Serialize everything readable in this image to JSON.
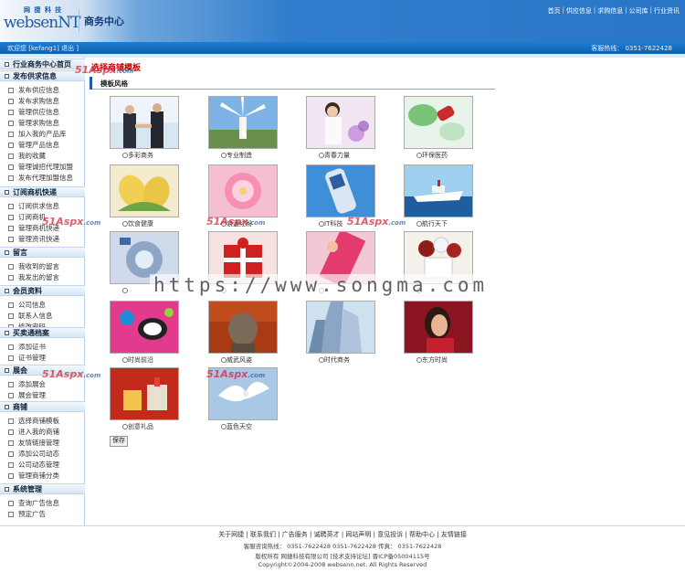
{
  "header": {
    "logo_small": "网 捷 科 技",
    "logo_main": "websenNT",
    "site_title": "商务中心",
    "nav": [
      "首页",
      "供应信息",
      "求购信息",
      "公司库",
      "行业资讯"
    ]
  },
  "info_bar": {
    "welcome": "欢迎您 [kefang1] 退出 ]",
    "hotline": "客服热线： 0351-7622428"
  },
  "sidebar": {
    "sections": [
      {
        "title": "行业商务中心首页",
        "items": []
      },
      {
        "title": "发布供求信息",
        "items": [
          "发布供应信息",
          "发布求购信息",
          "管理供应信息",
          "管理求购信息",
          "加入我的产品库",
          "管理产品信息",
          "我的收藏",
          "管理诚招代理加盟",
          "发布代理加盟信息"
        ]
      },
      {
        "title": "订阅商机快递",
        "items": [
          "订阅供求信息",
          "订阅商机",
          "管理商机快递",
          "管理资讯快递"
        ]
      },
      {
        "title": "留言",
        "items": [
          "我收到的留言",
          "我发出的留言"
        ]
      },
      {
        "title": "会员资料",
        "items": [
          "公司信息",
          "联系人信息",
          "修改密码"
        ]
      },
      {
        "title": "买卖通档案",
        "items": [
          "添加证书",
          "证书管理"
        ]
      },
      {
        "title": "展会",
        "items": [
          "添加展会",
          "展会管理"
        ]
      },
      {
        "title": "商铺",
        "items": [
          "选择商铺模板",
          "进入我的商铺",
          "友情链接管理",
          "添加公司动态",
          "公司动态管理",
          "管理商铺分类"
        ]
      },
      {
        "title": "系统管理",
        "items": [
          "查询广告信息",
          "预定广告"
        ]
      }
    ]
  },
  "main": {
    "title": "选择商铺模板",
    "section_label": "模板风格",
    "templates": [
      {
        "label": "多彩商务"
      },
      {
        "label": "专业制造"
      },
      {
        "label": "青春力量"
      },
      {
        "label": "环保医药"
      },
      {
        "label": "饮食健康"
      },
      {
        "label": "浪漫红粉"
      },
      {
        "label": "IT科技"
      },
      {
        "label": "航行天下"
      },
      {
        "label": ""
      },
      {
        "label": ""
      },
      {
        "label": ""
      },
      {
        "label": ""
      },
      {
        "label": "时尚前沿"
      },
      {
        "label": "威武风姿"
      },
      {
        "label": "时代商务"
      },
      {
        "label": "东方时尚"
      },
      {
        "label": "创意礼品"
      },
      {
        "label": "蓝色天空"
      }
    ],
    "save_label": "保存"
  },
  "watermarks": {
    "brand": "51Aspx",
    "suffix": ".com",
    "banner": "https://www.songma.com"
  },
  "footer": {
    "links": [
      "关于网捷",
      "联系我们",
      "广告服务",
      "诚聘英才",
      "网站声明",
      "意见投诉",
      "帮助中心",
      "友情链接"
    ],
    "line1": "客服咨询热线： 0351-7622428  0351-7622428  传真： 0351-7622428",
    "line2": "版权所有 网捷科技有限公司 [技术支持论坛] 晋ICP备05004115号",
    "line3": "Copyright©2004-2008 websenn.net. All Rights Reserved"
  },
  "colors": {
    "accent": "#2a76c6",
    "title_red": "#c80000",
    "nav_bar": "#0f5fae"
  }
}
